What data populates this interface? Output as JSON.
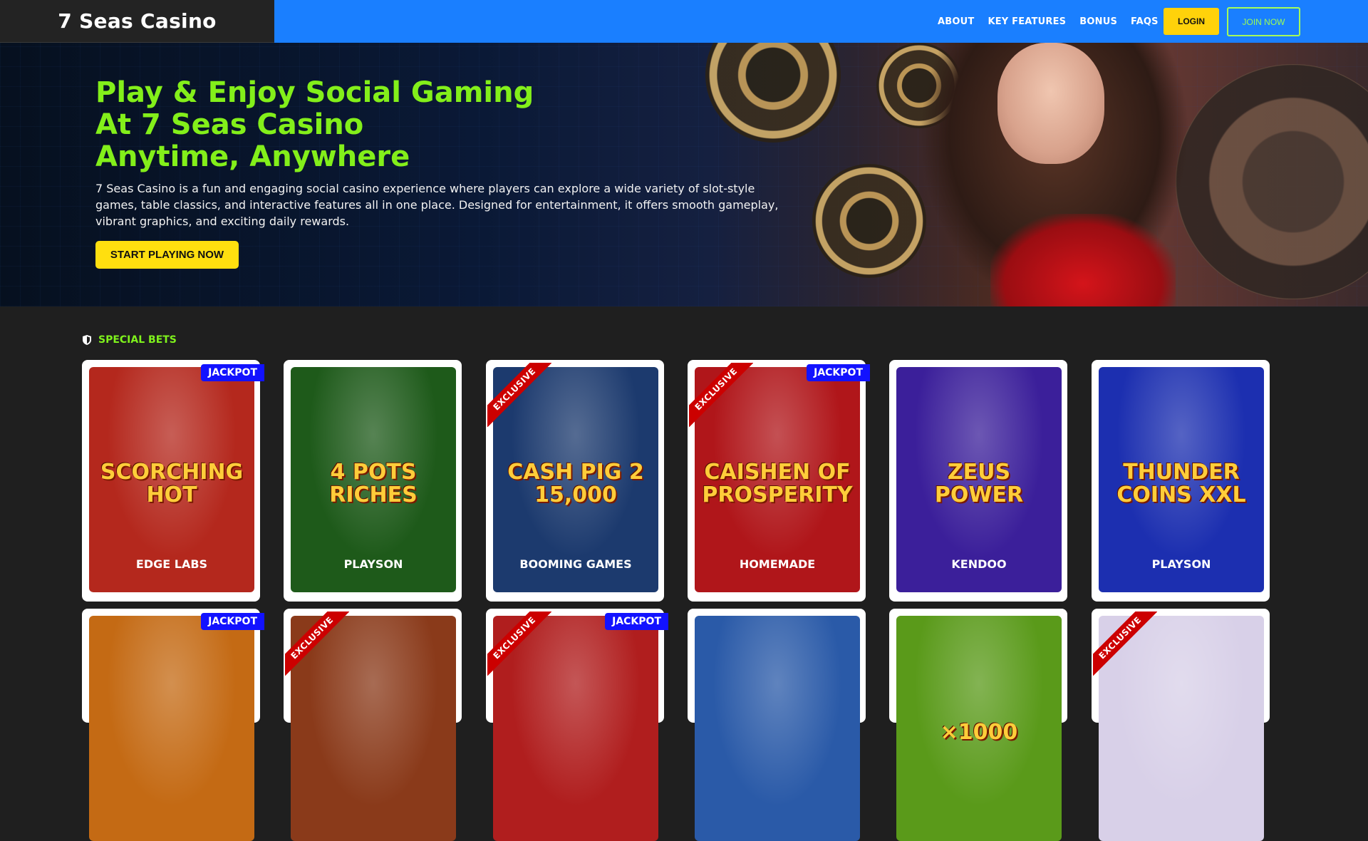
{
  "header": {
    "brand": "7 Seas Casino",
    "nav": [
      "ABOUT",
      "KEY FEATURES",
      "BONUS",
      "FAQS"
    ],
    "login_label": "LOGIN",
    "join_label": "JOIN NOW"
  },
  "hero": {
    "title_lines": [
      "Play & Enjoy Social Gaming",
      "At 7 Seas Casino",
      "Anytime, Anywhere"
    ],
    "description": "7 Seas Casino is a fun and engaging social casino experience where players can explore a wide variety of slot-style games, table classics, and interactive features all in one place. Designed for entertainment, it offers smooth gameplay, vibrant graphics, and exciting daily rewards.",
    "cta_label": "START PLAYING NOW"
  },
  "section": {
    "title": "SPECIAL BETS",
    "icon": "shield-icon"
  },
  "badges": {
    "jackpot": "JACKPOT",
    "exclusive": "EXCLUSIVE"
  },
  "games": [
    {
      "title": "SCORCHING HOT",
      "provider": "EDGE LABS",
      "badge": "jackpot",
      "bg": "#b4281d"
    },
    {
      "title": "4 POTS RICHES",
      "provider": "PLAYSON",
      "badge": "",
      "bg": "#1e5a1a"
    },
    {
      "title": "CASH PIG 2 15,000",
      "provider": "BOOMING GAMES",
      "badge": "exclusive",
      "bg": "#1c3a6e"
    },
    {
      "title": "CAISHEN OF PROSPERITY",
      "provider": "HOMEMADE",
      "badge": "both",
      "bg": "#b0161a"
    },
    {
      "title": "ZEUS POWER",
      "provider": "KENDOO",
      "badge": "",
      "bg": "#3b1f9a"
    },
    {
      "title": "THUNDER COINS XXL",
      "provider": "PLAYSON",
      "badge": "",
      "bg": "#1c2fb0"
    },
    {
      "title": "",
      "provider": "",
      "badge": "jackpot",
      "bg": "#c46a14"
    },
    {
      "title": "",
      "provider": "",
      "badge": "exclusive",
      "bg": "#8a3a1a"
    },
    {
      "title": "",
      "provider": "",
      "badge": "both",
      "bg": "#b01e1e"
    },
    {
      "title": "",
      "provider": "",
      "badge": "",
      "bg": "#2a5aa8"
    },
    {
      "title": "×1000",
      "provider": "",
      "badge": "",
      "bg": "#5a9a1a"
    },
    {
      "title": "",
      "provider": "",
      "badge": "exclusive",
      "bg": "#d8d0e8"
    }
  ]
}
